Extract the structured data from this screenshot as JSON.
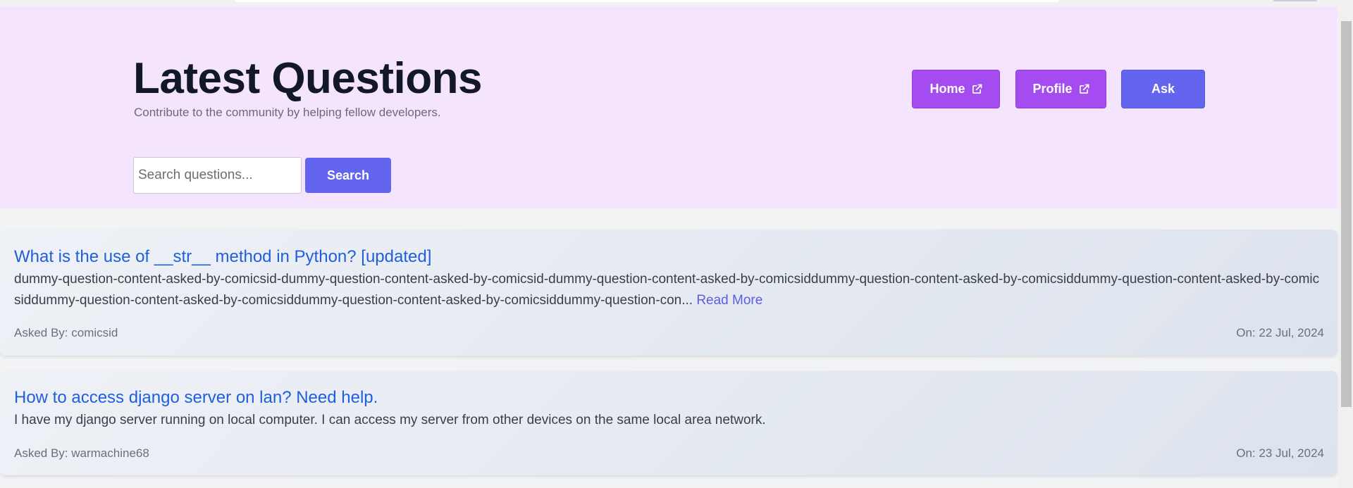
{
  "header": {
    "title": "Latest Questions",
    "subtitle": "Contribute to the community by helping fellow developers.",
    "nav": {
      "home_label": "Home",
      "profile_label": "Profile",
      "ask_label": "Ask"
    }
  },
  "search": {
    "placeholder": "Search questions...",
    "value": "",
    "button_label": "Search"
  },
  "questions": [
    {
      "title": "What is the use of __str__ method in Python? [updated]",
      "excerpt": "dummy-question-content-asked-by-comicsid-dummy-question-content-asked-by-comicsid-dummy-question-content-asked-by-comicsiddummy-question-content-asked-by-comicsiddummy-question-content-asked-by-comicsiddummy-question-content-asked-by-comicsiddummy-question-content-asked-by-comicsiddummy-question-con...",
      "read_more": "Read More",
      "asked_by": "Asked By: comicsid",
      "date": "On: 22 Jul, 2024"
    },
    {
      "title": "How to access django server on lan? Need help.",
      "excerpt": "I have my django server running on local computer. I can access my server from other devices on the same local area network.",
      "asked_by": "Asked By: warmachine68",
      "date": "On: 23 Jul, 2024"
    }
  ],
  "colors": {
    "hero_bg": "#f4e4fd",
    "nav_purple": "#a54cf0",
    "primary_indigo": "#6465ef",
    "link_blue": "#1f5fdc"
  },
  "icons": {
    "home_button_icon": "external-link-icon",
    "profile_button_icon": "external-link-icon"
  }
}
